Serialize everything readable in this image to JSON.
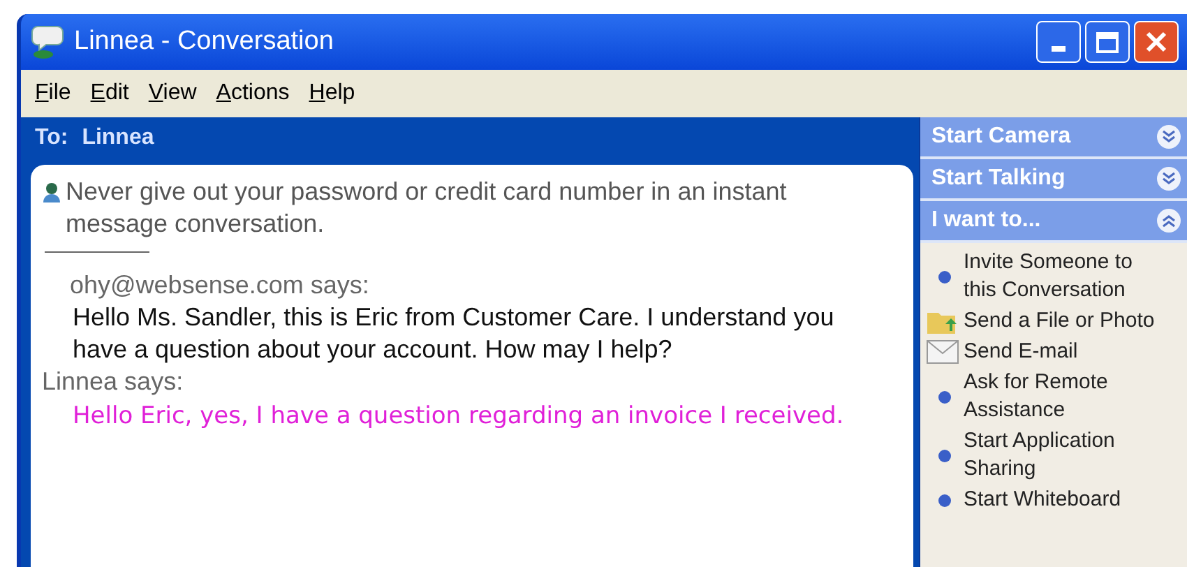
{
  "window": {
    "title": "Linnea - Conversation"
  },
  "menu": [
    {
      "label": "File",
      "underline_first": true
    },
    {
      "label": "Edit",
      "underline_first": true
    },
    {
      "label": "View",
      "underline_first": true
    },
    {
      "label": "Actions",
      "underline_first": true
    },
    {
      "label": "Help",
      "underline_first": true
    }
  ],
  "to_bar": {
    "label": "To:",
    "name": "Linnea"
  },
  "conversation": [
    {
      "kind": "warning",
      "text": "Never give out your password or credit card number in an instant message conversation."
    },
    {
      "kind": "sender",
      "text": "ohy@websense.com says:"
    },
    {
      "kind": "message",
      "text": "Hello Ms. Sandler, this is Eric from Customer Care.  I understand you have a question about your account.  How may I help?",
      "color": "#111111"
    },
    {
      "kind": "sender",
      "text": "Linnea says:"
    },
    {
      "kind": "message",
      "text": "Hello Eric, yes, I have a question regarding an invoice I received.",
      "color": "#e020d8"
    }
  ],
  "task_pane": {
    "sections": [
      {
        "title": "Start Camera",
        "expanded": false
      },
      {
        "title": "Start Talking",
        "expanded": false
      },
      {
        "title": "I want to...",
        "expanded": true,
        "items": [
          {
            "kind": "bullet",
            "label": "Invite Someone to this Conversation"
          },
          {
            "kind": "folder",
            "label": "Send a File or Photo"
          },
          {
            "kind": "envelope",
            "label": "Send E-mail"
          },
          {
            "kind": "bullet",
            "label": "Ask for Remote Assistance"
          },
          {
            "kind": "bullet",
            "label": "Start Application Sharing"
          },
          {
            "kind": "bullet",
            "label": "Start Whiteboard"
          }
        ]
      }
    ]
  }
}
